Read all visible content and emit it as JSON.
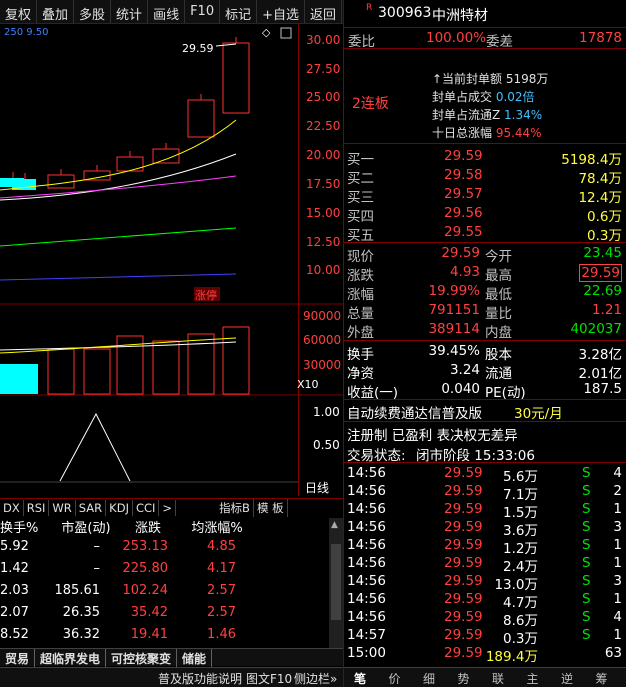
{
  "toolbar": {
    "items": [
      "复权",
      "叠加",
      "多股",
      "统计",
      "画线",
      "F10",
      "标记",
      "+自选",
      "返回"
    ]
  },
  "chart": {
    "ma_info": [
      "250",
      "9.50"
    ],
    "price_axis": [
      "30.00",
      "27.50",
      "25.00",
      "22.50",
      "20.00",
      "17.50",
      "15.00",
      "12.50",
      "10.00"
    ],
    "high_label": "29.59",
    "zhangting_tag": "涨停",
    "vol_axis": [
      "90000",
      "60000",
      "30000"
    ],
    "vol_unit": "X10",
    "ind_axis": [
      "1.00",
      "0.50"
    ],
    "period_label": "日线",
    "colors": {
      "up": "#ff3030",
      "down": "#00ffff",
      "ma1": "#ffffff",
      "ma2": "#ffff00",
      "ma3": "#ff40ff",
      "ma4": "#00ff00",
      "ma5": "#4040ff"
    }
  },
  "ind_tabs": [
    "DX",
    "RSI",
    "WR",
    "SAR",
    "KDJ",
    "CCI",
    ">"
  ],
  "ind_buttons": [
    "指标B",
    "模 板"
  ],
  "table": {
    "headers": [
      "换手%",
      "市盈(动)",
      "涨跌",
      "均涨幅%"
    ],
    "rows": [
      [
        "5.92",
        "–",
        "253.13",
        "4.85"
      ],
      [
        "1.42",
        "–",
        "225.80",
        "4.17"
      ],
      [
        "2.03",
        "185.61",
        "102.24",
        "2.57"
      ],
      [
        "2.07",
        "26.35",
        "35.42",
        "2.57"
      ],
      [
        "8.52",
        "36.32",
        "19.41",
        "1.46"
      ]
    ]
  },
  "bottom_tabs": [
    "贸易",
    "超临界发电",
    "可控核聚变",
    "储能"
  ],
  "status_bar": [
    "普及版功能说明",
    "图文F10",
    "侧边栏»"
  ],
  "stock": {
    "code": "300963",
    "name": "中洲特材",
    "badge": "R"
  },
  "weibi": {
    "label1": "委比",
    "val1": "100.00%",
    "label2": "委差",
    "val2": "17878"
  },
  "limit": {
    "streak": "2连板",
    "items": [
      {
        "label": "当前封单额",
        "value": "5198万"
      },
      {
        "label": "封单占成交",
        "value": "0.02倍"
      },
      {
        "label": "封单占流通Z",
        "value": "1.34%"
      },
      {
        "label": "十日总涨幅",
        "value": "95.44%"
      }
    ]
  },
  "book": [
    {
      "label": "买一",
      "price": "29.59",
      "vol": "5198.4万"
    },
    {
      "label": "买二",
      "price": "29.58",
      "vol": "78.4万"
    },
    {
      "label": "买三",
      "price": "29.57",
      "vol": "12.4万"
    },
    {
      "label": "买四",
      "price": "29.56",
      "vol": "0.6万"
    },
    {
      "label": "买五",
      "price": "29.55",
      "vol": "0.3万"
    }
  ],
  "quote": [
    {
      "l1": "现价",
      "v1": "29.59",
      "l2": "今开",
      "v2": "23.45"
    },
    {
      "l1": "涨跌",
      "v1": "4.93",
      "l2": "最高",
      "v2": "29.59"
    },
    {
      "l1": "涨幅",
      "v1": "19.99%",
      "l2": "最低",
      "v2": "22.69"
    },
    {
      "l1": "总量",
      "v1": "791151",
      "l2": "量比",
      "v2": "1.21"
    },
    {
      "l1": "外盘",
      "v1": "389114",
      "l2": "内盘",
      "v2": "402037"
    }
  ],
  "fund": [
    {
      "l1": "换手",
      "v1": "39.45%",
      "l2": "股本",
      "v2": "3.28亿"
    },
    {
      "l1": "净资",
      "v1": "3.24",
      "l2": "流通",
      "v2": "2.01亿"
    },
    {
      "l1": "收益(一)",
      "v1": "0.040",
      "l2": "PE(动)",
      "v2": "187.5"
    }
  ],
  "promo": {
    "text": "自动续费通达信普及版",
    "price": "30元/月"
  },
  "register": "注册制 已盈利 表决权无差异",
  "trade_status": {
    "label": "交易状态:",
    "value": "闭市阶段 15:33:06"
  },
  "ticks": [
    {
      "t": "14:56",
      "p": "29.59",
      "v": "5.6万",
      "s": "S",
      "n": "4"
    },
    {
      "t": "14:56",
      "p": "29.59",
      "v": "7.1万",
      "s": "S",
      "n": "2"
    },
    {
      "t": "14:56",
      "p": "29.59",
      "v": "1.5万",
      "s": "S",
      "n": "1"
    },
    {
      "t": "14:56",
      "p": "29.59",
      "v": "3.6万",
      "s": "S",
      "n": "3"
    },
    {
      "t": "14:56",
      "p": "29.59",
      "v": "1.2万",
      "s": "S",
      "n": "1"
    },
    {
      "t": "14:56",
      "p": "29.59",
      "v": "2.4万",
      "s": "S",
      "n": "1"
    },
    {
      "t": "14:56",
      "p": "29.59",
      "v": "13.0万",
      "s": "S",
      "n": "3"
    },
    {
      "t": "14:56",
      "p": "29.59",
      "v": "4.7万",
      "s": "S",
      "n": "1"
    },
    {
      "t": "14:56",
      "p": "29.59",
      "v": "8.6万",
      "s": "S",
      "n": "4"
    },
    {
      "t": "14:57",
      "p": "29.59",
      "v": "0.3万",
      "s": "S",
      "n": "1"
    },
    {
      "t": "15:00",
      "p": "29.59",
      "v": "189.4万",
      "s": "",
      "n": "63"
    }
  ],
  "right_tabs": [
    "笔",
    "价",
    "细",
    "势",
    "联",
    "主",
    "逆",
    "筹"
  ]
}
